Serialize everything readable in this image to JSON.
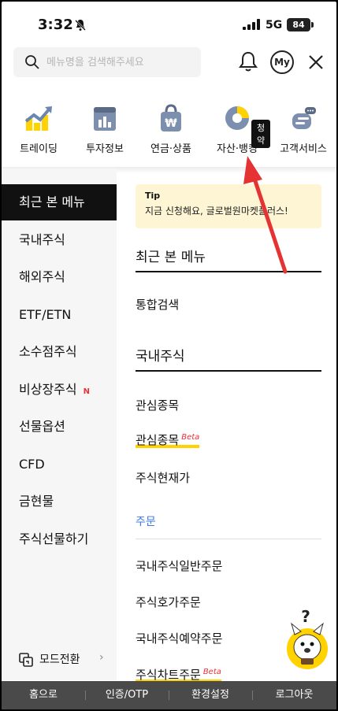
{
  "status": {
    "time": "3:32",
    "network": "5G",
    "battery": "84"
  },
  "search": {
    "placeholder": "메뉴명을 검색해주세요"
  },
  "header": {
    "my_label": "My"
  },
  "categories": [
    {
      "label": "트레이딩",
      "icon": "chart-up-icon"
    },
    {
      "label": "투자정보",
      "icon": "report-icon"
    },
    {
      "label": "연금·상품",
      "icon": "bag-icon"
    },
    {
      "label": "자산·뱅킹",
      "icon": "pie-icon",
      "badge": "청약"
    },
    {
      "label": "고객서비스",
      "icon": "chat-icon"
    }
  ],
  "left_menu": [
    {
      "label": "최근 본 메뉴",
      "active": true
    },
    {
      "label": "국내주식"
    },
    {
      "label": "해외주식"
    },
    {
      "label": "ETF/ETN"
    },
    {
      "label": "소수점주식"
    },
    {
      "label": "비상장주식",
      "new": "N"
    },
    {
      "label": "선물옵션"
    },
    {
      "label": "CFD"
    },
    {
      "label": "금현물"
    },
    {
      "label": "주식선물하기"
    }
  ],
  "mode_switch": {
    "label": "모드전환",
    "arrow": "›"
  },
  "tip": {
    "title": "Tip",
    "body": "지금 신청해요, 글로벌원마켓플러스!"
  },
  "content": {
    "recent_title": "최근 본 메뉴",
    "recent_items": [
      "통합검색"
    ],
    "domestic_title": "국내주식",
    "domestic_items": [
      {
        "label": "관심종목"
      },
      {
        "label": "관심종목",
        "beta": "Beta"
      },
      {
        "label": "주식현재가"
      }
    ],
    "order_sub": "주문",
    "order_items": [
      {
        "label": "국내주식일반주문"
      },
      {
        "label": "주식호가주문"
      },
      {
        "label": "국내주식예약주문"
      },
      {
        "label": "주식차트주문",
        "beta": "Beta"
      }
    ]
  },
  "mascot": {
    "mark": "?"
  },
  "bottom_bar": [
    "홈으로",
    "인증/OTP",
    "환경설정",
    "로그아웃"
  ],
  "colors": {
    "accent_red": "#e8323a",
    "highlight_yellow": "#ffd200",
    "tip_bg": "#fdf5d3",
    "sub_blue": "#3b78e7"
  }
}
